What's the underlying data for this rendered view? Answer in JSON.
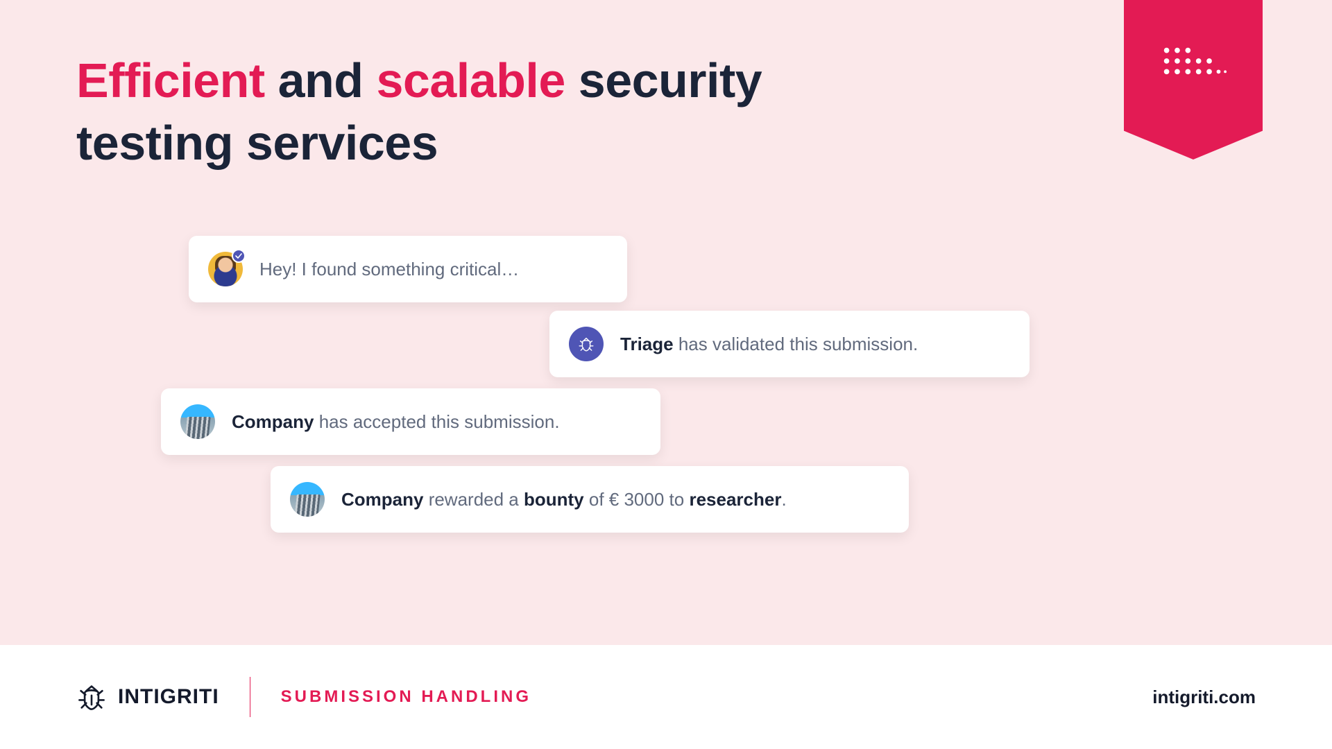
{
  "headline": {
    "w1": "Efficient",
    "mid1": " and ",
    "w2": "scalable",
    "tail": " security\ntesting services"
  },
  "cards": {
    "researcher_msg": "Hey! I found something critical…",
    "triage": {
      "bold": "Triage",
      "rest": " has validated this submission."
    },
    "accepted": {
      "bold": "Company",
      "rest": " has accepted this submission."
    },
    "bounty": {
      "b1": "Company",
      "t1": " rewarded a ",
      "b2": "bounty",
      "t2": " of € 3000 to ",
      "b3": "researcher",
      "t3": "."
    }
  },
  "footer": {
    "brand": "INTIGRITI",
    "category": "SUBMISSION HANDLING",
    "site": "intigriti.com"
  }
}
